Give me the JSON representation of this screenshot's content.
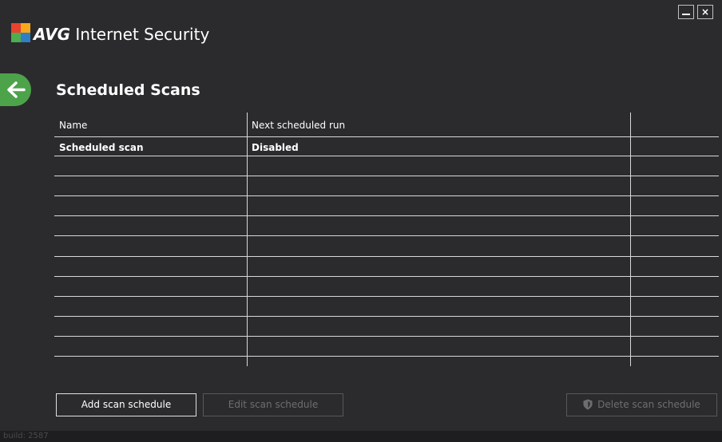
{
  "app": {
    "brand": "AVG",
    "product": "Internet Security"
  },
  "window_controls": {
    "minimize": "_",
    "close": "×"
  },
  "page": {
    "title": "Scheduled Scans"
  },
  "table": {
    "columns": [
      "Name",
      "Next scheduled run",
      ""
    ],
    "rows": [
      [
        "Scheduled scan",
        "Disabled",
        ""
      ]
    ]
  },
  "buttons": {
    "add": "Add scan schedule",
    "edit": "Edit scan schedule",
    "delete": "Delete scan schedule"
  },
  "status": {
    "build": "build: 2587"
  },
  "colors": {
    "background": "#2b2b2e",
    "back_button": "#4da34a",
    "logo_red": "#e8432e",
    "logo_orange": "#f7a91b",
    "logo_green": "#4cae4f",
    "logo_blue": "#2e7fc4"
  },
  "icons": {
    "back": "arrow-left-icon",
    "logo": "avg-logo-icon",
    "delete": "shield-icon"
  }
}
